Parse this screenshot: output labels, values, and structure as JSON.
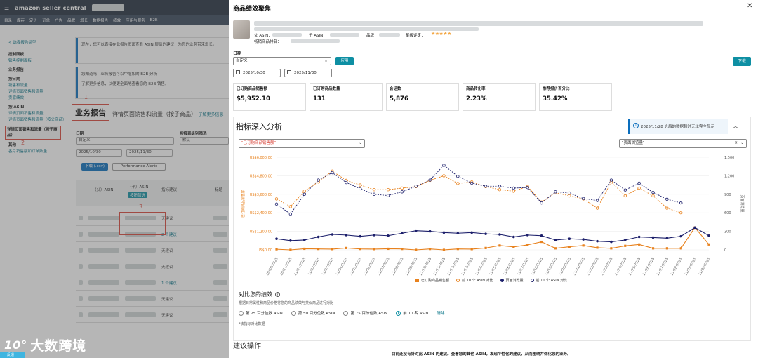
{
  "background": {
    "brand": "amazon seller central",
    "nav_items": [
      "目录",
      "库存",
      "定价",
      "订单",
      "广告",
      "品牌",
      "增长",
      "数据报告",
      "绩效",
      "应用与服务",
      "B2B"
    ],
    "back_link": "< 选择报告类型",
    "sidebar": [
      {
        "label": "控制面板",
        "type": "head"
      },
      {
        "label": "销售控制面板",
        "type": "link"
      },
      {
        "label": "业务报告",
        "type": "head"
      },
      {
        "label": "按日期",
        "type": "head"
      },
      {
        "label": "销售和流量",
        "type": "link"
      },
      {
        "label": "详情页面销售和流量",
        "type": "link"
      },
      {
        "label": "卖家绩效",
        "type": "link"
      },
      {
        "label": "按 ASIN",
        "type": "head"
      },
      {
        "label": "详情页面销售和流量",
        "type": "link"
      },
      {
        "label": "详情页面销售和流量（按父商品）",
        "type": "link"
      },
      {
        "label": "详情页面销售和流量（按子商品）",
        "type": "active"
      },
      {
        "label": "其他",
        "type": "head"
      },
      {
        "label": "各月销售额和订单数量",
        "type": "link"
      }
    ],
    "banner1": "现在，您可以直接在此报告页面查看 ASIN 层级的建议，为您的业务带来增长。",
    "banner2": "您知道吗：业务报告可以中增加的 B2B 分析",
    "banner2b": "了解更多信息，以便更全面地查看您的 B2B 销售。",
    "report_title": "业务报告",
    "report_sub": "详情页面销售和流量（按子商品）",
    "report_link": "了解更多信息",
    "date_label": "日期",
    "date_value": "自定义",
    "date_from": "2025/10/30",
    "date_to": "2025/11/30",
    "display_label": "按报表级别筛选",
    "display_value": "默认",
    "download_label": "下载 (.csv)",
    "perf_alerts_label": "Performance Alerts",
    "col_parent": "（父）ASIN",
    "col_child": "（子）ASIN",
    "col_sugg": "指标建议",
    "col_title": "标题",
    "child_badge": "按钮筛选",
    "rows": [
      {
        "sugg": "无建议",
        "link": false
      },
      {
        "sugg": "2 个建议",
        "link": true
      },
      {
        "sugg": "无建议",
        "link": false
      },
      {
        "sugg": "无建议",
        "link": false
      },
      {
        "sugg": "1 个建议",
        "link": true
      },
      {
        "sugg": "无建议",
        "link": false
      },
      {
        "sugg": "无建议",
        "link": false
      }
    ],
    "annotations": [
      "1",
      "2",
      "3"
    ],
    "watermark": "大数跨境",
    "bottom_tag": "反馈"
  },
  "panel": {
    "title": "商品绩效聚焦",
    "parent_asin_label": "父 ASIN：",
    "child_asin_label": "子 ASIN：",
    "brand_label": "品牌：",
    "rating_label": "星级评定：",
    "stars": "★★★★★",
    "rank_label": "畅销商品排名：",
    "date_label": "日期",
    "date_value": "自定义",
    "apply_label": "应用",
    "download_label": "下载",
    "date_from": "2025/10/30",
    "date_to": "2025/11/30",
    "kpis": [
      {
        "label": "已订购商品销售额",
        "value": "$5,952.10"
      },
      {
        "label": "已订购商品数量",
        "value": "131"
      },
      {
        "label": "会话数",
        "value": "5,876"
      },
      {
        "label": "商品转化率",
        "value": "2.23%"
      },
      {
        "label": "推荐报价百分比",
        "value": "35.42%"
      }
    ],
    "deep_dive_title": "指标深入分析",
    "notice": "2025/11/28 之后的数据暂时无法完全显示",
    "metric_left": "\"已订购商品销售额\"",
    "metric_right": "\"页面浏览量\"",
    "compare_title": "对比您的绩效",
    "compare_desc": "根据日常属性和商品价格将您的商品绩效与类似商品进行对比",
    "radio_options": [
      {
        "label": "第 25 百分位数 ASIN",
        "on": false
      },
      {
        "label": "第 50 百分位数 ASIN",
        "on": false
      },
      {
        "label": "第 75 百分位数 ASIN",
        "on": false
      },
      {
        "label": "前 10 名 ASIN",
        "on": true
      }
    ],
    "clear_label": "清除",
    "compare_note": "*该指标对比数据",
    "suggest_title": "建议操作",
    "suggest_text": "目前还没有针对此 ASIN 的建议。查看您的其他 ASIN，发现个性化的建议，从而围绕并优化您的业务。"
  },
  "chart_data": {
    "type": "line",
    "x": [
      "10/30/2025",
      "10/31/2025",
      "11/01/2025",
      "11/02/2025",
      "11/03/2025",
      "11/04/2025",
      "11/05/2025",
      "11/06/2025",
      "11/07/2025",
      "11/08/2025",
      "11/09/2025",
      "11/10/2025",
      "11/11/2025",
      "11/12/2025",
      "11/13/2025",
      "11/14/2025",
      "11/15/2025",
      "11/16/2025",
      "11/17/2025",
      "11/18/2025",
      "11/19/2025",
      "11/20/2025",
      "11/21/2025",
      "11/22/2025",
      "11/23/2025",
      "11/24/2025",
      "11/25/2025",
      "11/26/2025",
      "11/27/2025",
      "11/28/2025",
      "11/29/2025",
      "11/30/2025"
    ],
    "y_left_ticks": [
      "US$6,000.00",
      "US$4,800.00",
      "US$3,600.00",
      "US$2,400.00",
      "US$1,200.00",
      "US$0.00"
    ],
    "y_right_ticks": [
      "1,500",
      "1,200",
      "900",
      "600",
      "300",
      "0"
    ],
    "ylim_left": [
      0,
      6000
    ],
    "ylim_right": [
      0,
      1500
    ],
    "ylabel_left": "已订购商品销售额",
    "ylabel_right": "页面浏览量",
    "series": [
      {
        "name": "已订购商品销售额",
        "axis": "left",
        "style": "solid",
        "color": "#e8821e",
        "marker": "square",
        "values": [
          40,
          0,
          70,
          60,
          50,
          120,
          60,
          50,
          70,
          60,
          0,
          60,
          0,
          60,
          50,
          120,
          280,
          190,
          320,
          520,
          100,
          200,
          280,
          140,
          100,
          260,
          350,
          100,
          100,
          100,
          1450,
          350
        ]
      },
      {
        "name": "前 10 个 ASIN 对比",
        "axis": "left",
        "style": "dashed",
        "color": "#e8821e",
        "marker": "circle",
        "values": [
          3300,
          2800,
          3800,
          4400,
          5100,
          4500,
          4200,
          3900,
          3900,
          4000,
          4100,
          4500,
          4800,
          4300,
          4400,
          4100,
          3900,
          3800,
          4100,
          3100,
          3700,
          3500,
          3300,
          2700,
          4400,
          3500,
          4000,
          3500,
          2700,
          2400,
          null,
          null
        ]
      },
      {
        "name": "页面浏览量",
        "axis": "right",
        "style": "solid",
        "color": "#1c1f6b",
        "marker": "dot",
        "values": [
          180,
          150,
          160,
          210,
          250,
          240,
          220,
          240,
          230,
          270,
          310,
          300,
          280,
          270,
          280,
          260,
          250,
          210,
          240,
          230,
          160,
          180,
          170,
          140,
          130,
          160,
          210,
          200,
          190,
          220,
          360,
          230
        ]
      },
      {
        "name": "前 10 个 ASIN 对比",
        "axis": "right",
        "style": "dashed",
        "color": "#1c1f6b",
        "marker": "circle",
        "values": [
          740,
          580,
          900,
          1130,
          1250,
          1090,
          990,
          900,
          880,
          940,
          1030,
          1130,
          1370,
          1190,
          1080,
          1030,
          1030,
          1000,
          1010,
          760,
          940,
          920,
          830,
          800,
          1130,
          970,
          1080,
          930,
          820,
          760,
          null,
          null
        ]
      }
    ],
    "legend_position": "bottom"
  },
  "colors": {
    "accent": "#0e8fa3",
    "annotation": "#d9453a",
    "orange": "#e8821e",
    "navy": "#1c1f6b"
  }
}
